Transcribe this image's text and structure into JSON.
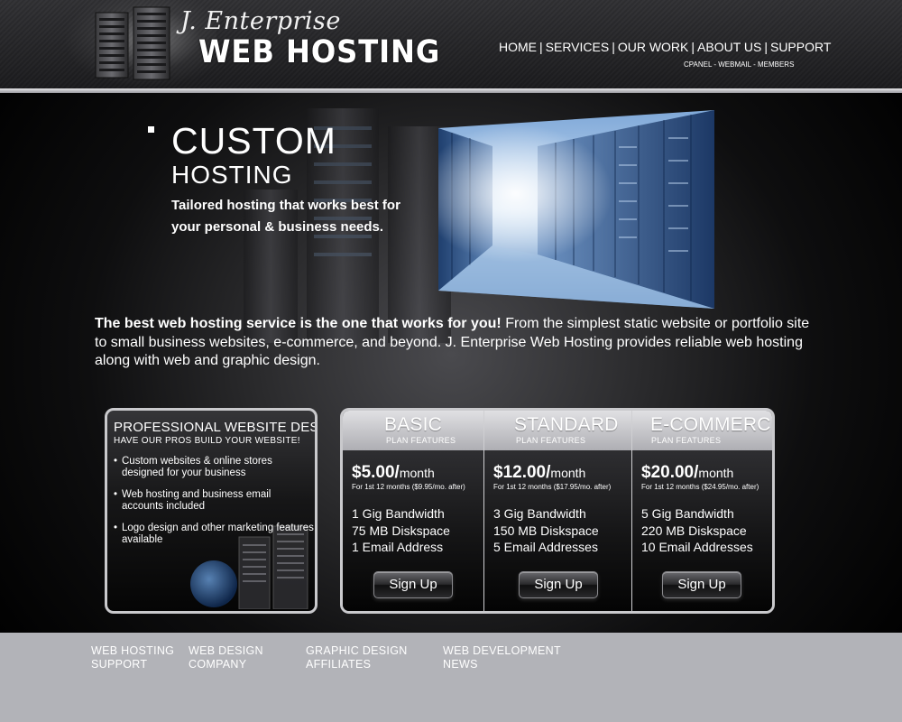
{
  "header": {
    "logo_script": "J. Enterprise",
    "logo_main": "WEB HOSTING",
    "nav": [
      "HOME",
      "SERVICES",
      "OUR WORK",
      "ABOUT US",
      "SUPPORT"
    ],
    "subnav": [
      "CPANEL",
      "WEBMAIL",
      "MEMBERS"
    ],
    "subnav_sep": " - "
  },
  "hero": {
    "title": "CUSTOM",
    "subtitle": "HOSTING",
    "tagline": "Tailored hosting that works best for your personal & business needs."
  },
  "intro": {
    "lead": "The best web hosting service is the one that works for you!",
    "body": " From the simplest static website or portfolio site to small business websites, e-commerce, and beyond. J. Enterprise Web Hosting provides reliable web hosting along with web and graphic design."
  },
  "design_box": {
    "title": "PROFESSIONAL WEBSITE DESIGN",
    "subtitle": "HAVE OUR PROS BUILD YOUR WEBSITE!",
    "items": [
      "Custom websites & online stores designed for your business",
      "Web hosting and business email accounts included",
      "Logo design and other marketing features available"
    ]
  },
  "plans": [
    {
      "name": "BASIC",
      "features_label": "PLAN FEATURES",
      "price": "$5.00/",
      "period": "month",
      "note": "For 1st 12 months ($9.95/mo. after)",
      "specs": [
        "1 Gig Bandwidth",
        "75 MB Diskspace",
        "1 Email Address"
      ],
      "button": "Sign Up"
    },
    {
      "name": "STANDARD",
      "features_label": "PLAN FEATURES",
      "price": "$12.00/",
      "period": "month",
      "note": "For 1st 12 months ($17.95/mo. after)",
      "specs": [
        "3 Gig Bandwidth",
        "150 MB Diskspace",
        "5 Email Addresses"
      ],
      "button": "Sign Up"
    },
    {
      "name": "E-COMMERCE",
      "features_label": "PLAN FEATURES",
      "price": "$20.00/",
      "period": "month",
      "note": "For 1st 12 months ($24.95/mo. after)",
      "specs": [
        "5 Gig Bandwidth",
        "220 MB Diskspace",
        "10 Email Addresses"
      ],
      "button": "Sign Up"
    }
  ],
  "footer": {
    "columns": [
      [
        "WEB HOSTING",
        "SUPPORT"
      ],
      [
        "WEB DESIGN",
        "COMPANY"
      ],
      [
        "GRAPHIC DESIGN",
        "AFFILIATES"
      ],
      [
        "WEB DEVELOPMENT",
        "NEWS"
      ]
    ]
  },
  "colors": {
    "header_bg": "#262629",
    "footer_bg": "#b2b3b8",
    "plan_header_bg": "#c8c8cc",
    "box_border": "#c9c9cc"
  }
}
